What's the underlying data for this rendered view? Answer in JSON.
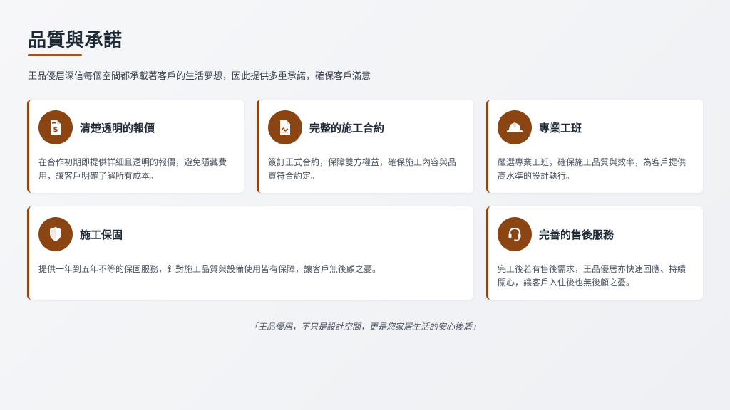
{
  "header": {
    "title": "品質與承諾",
    "subtitle": "王品優居深信每個空間都承載著客戶的生活夢想，因此提供多重承諾，確保客戶滿意"
  },
  "cards": [
    {
      "icon": "invoice-dollar-icon",
      "title": "清楚透明的報價",
      "text": "在合作初期即提供詳細且透明的報價，避免隱藏費用，讓客戶明確了解所有成本。"
    },
    {
      "icon": "signed-contract-icon",
      "title": "完整的施工合約",
      "text": "簽訂正式合約，保障雙方權益，確保施工內容與品質符合約定。"
    },
    {
      "icon": "hard-hat-icon",
      "title": "專業工班",
      "text": "嚴選專業工班，確保施工品質與效率，為客戶提供高水準的設計執行。"
    },
    {
      "icon": "shield-icon",
      "title": "施工保固",
      "text": "提供一年到五年不等的保固服務，針對施工品質與設備使用皆有保障，讓客戶無後顧之憂。"
    },
    {
      "icon": "headset-icon",
      "title": "完善的售後服務",
      "text": "完工後若有售後需求，王品優居亦快速回應、持續關心，讓客戶入住後也無後顧之憂。"
    }
  ],
  "footer": "「王品優居，不只是設計空間，更是您家居生活的安心後盾」",
  "colors": {
    "accent": "#8b4513",
    "title_underline": "#a0522d"
  }
}
